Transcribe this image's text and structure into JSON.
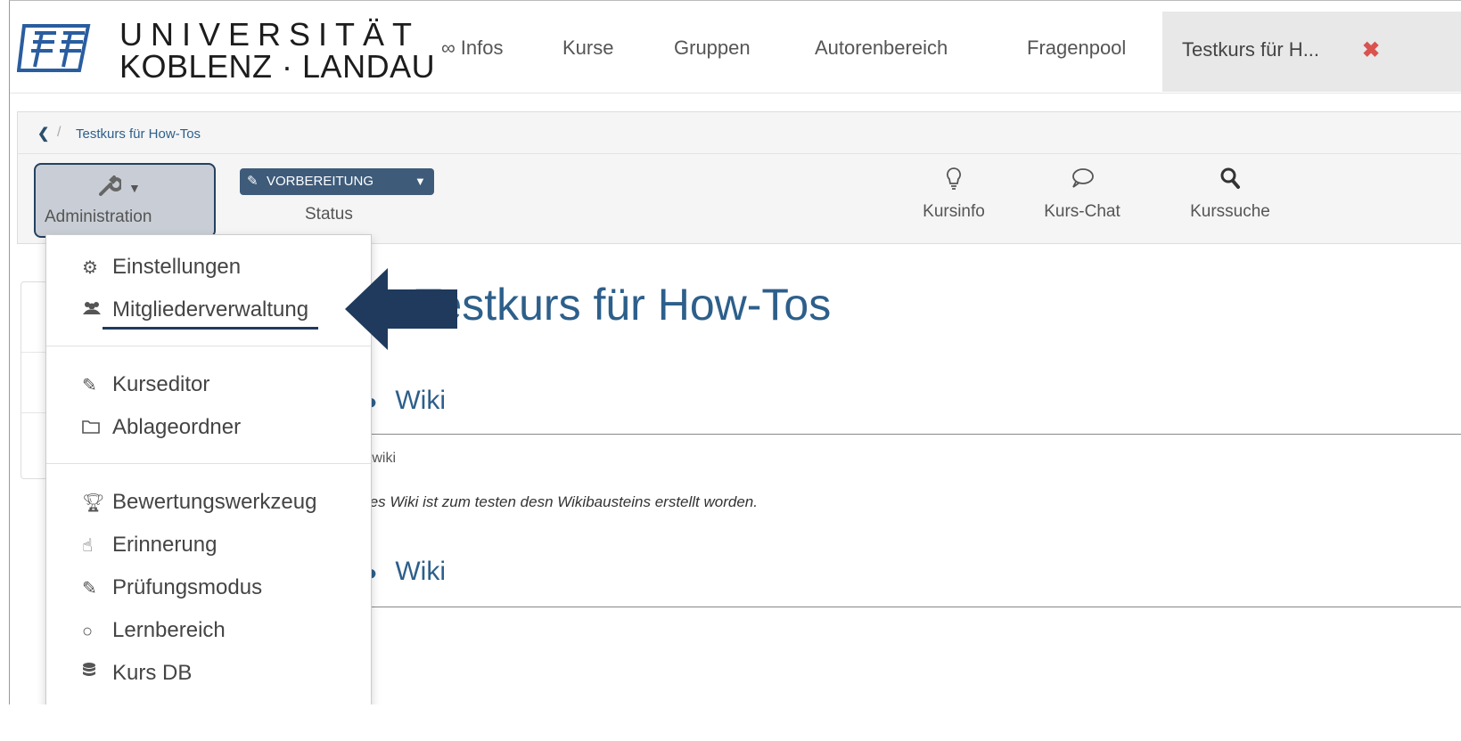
{
  "brand": {
    "line1": "UNIVERSITÄT",
    "line2": "KOBLENZ · LANDAU"
  },
  "topnav": {
    "items": [
      {
        "label": "∞ Infos"
      },
      {
        "label": "Kurse"
      },
      {
        "label": "Gruppen"
      },
      {
        "label": "Autorenbereich"
      },
      {
        "label": "Fragenpool"
      }
    ],
    "active_tab": {
      "label": "Testkurs für H...",
      "close_icon": "✖"
    }
  },
  "breadcrumb": {
    "back_icon": "‹",
    "separator": "/",
    "current": "Testkurs für How-Tos"
  },
  "toolbar": {
    "admin_label": "Administration",
    "status_badge": "VORBEREITUNG",
    "status_label": "Status",
    "tools": [
      {
        "label": "Kursinfo",
        "icon": "lightbulb-icon"
      },
      {
        "label": "Kurs-Chat",
        "icon": "chat-icon"
      },
      {
        "label": "Kurssuche",
        "icon": "search-icon"
      }
    ]
  },
  "dropdown": {
    "group1": [
      {
        "label": "Einstellungen",
        "icon": "gears-icon"
      },
      {
        "label": "Mitgliederverwaltung",
        "icon": "users-icon"
      }
    ],
    "group2": [
      {
        "label": "Kurseditor",
        "icon": "edit-icon"
      },
      {
        "label": "Ablageordner",
        "icon": "folder-icon"
      }
    ],
    "group3": [
      {
        "label": "Bewertungswerkzeug",
        "icon": "trophy-icon"
      },
      {
        "label": "Erinnerung",
        "icon": "pointer-icon"
      },
      {
        "label": "Prüfungsmodus",
        "icon": "edit-icon"
      },
      {
        "label": "Lernbereich",
        "icon": "circle-icon"
      },
      {
        "label": "Kurs DB",
        "icon": "database-icon"
      }
    ]
  },
  "main": {
    "title": "Testkurs für How-Tos",
    "sections": [
      {
        "heading": "Wiki",
        "subtitle": "estwiki",
        "text": "ieses Wiki ist zum testen desn Wikibausteins erstellt worden."
      },
      {
        "heading": "Wiki"
      }
    ]
  },
  "colors": {
    "accent": "#2d5f8b",
    "badge": "#3e5b7a",
    "arrow": "#1f3a5c",
    "close": "#d9534f"
  }
}
